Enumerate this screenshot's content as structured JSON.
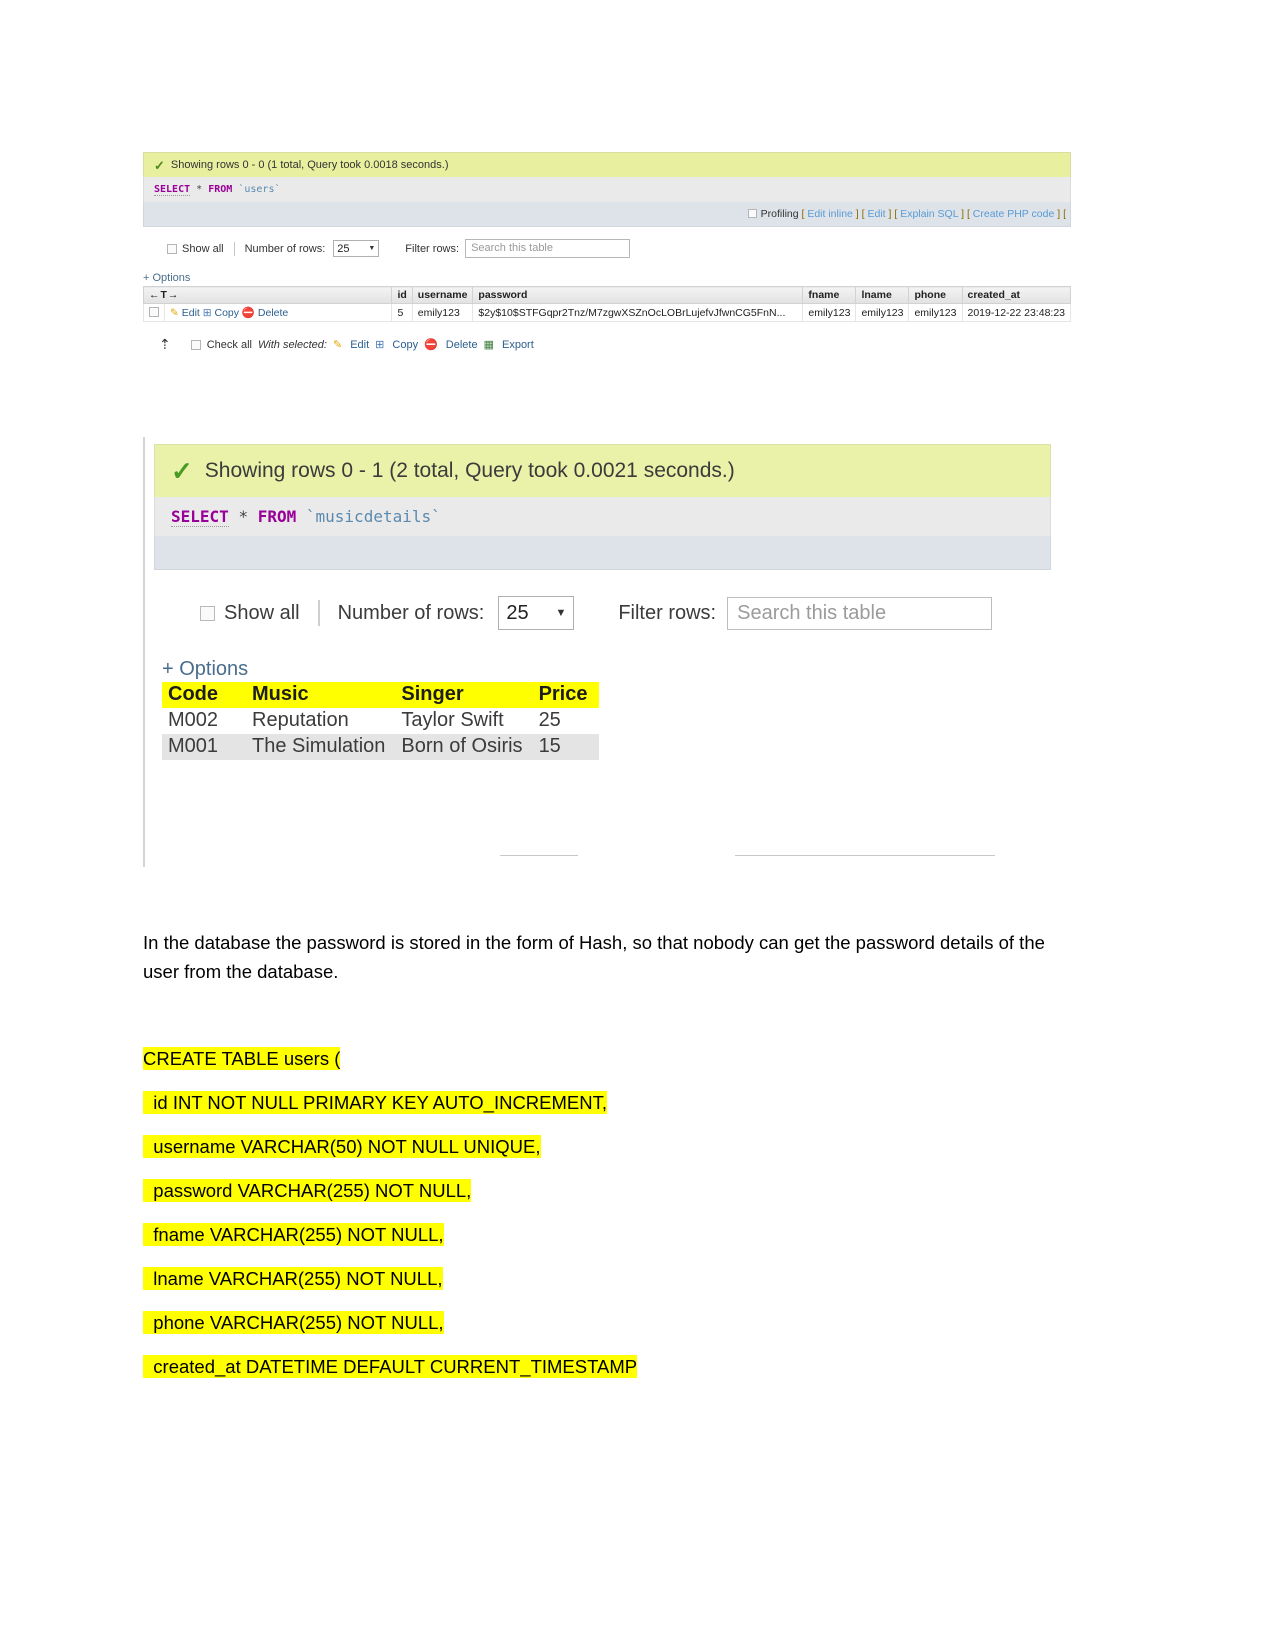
{
  "shot1": {
    "success_text": "Showing rows 0 - 0 (1 total, Query took 0.0018 seconds.)",
    "sql": {
      "keyword": "SELECT",
      "star": "*",
      "from": "FROM",
      "table": "`users`"
    },
    "links": {
      "profiling": "Profiling",
      "edit_inline": "Edit inline",
      "edit": "Edit",
      "explain_sql": "Explain SQL",
      "create_php": "Create PHP code",
      "bracket_open": "[",
      "bracket_close": "]",
      "pipe": "|"
    },
    "controls": {
      "show_all": "Show all",
      "number_of_rows_label": "Number of rows:",
      "number_of_rows_value": "25",
      "filter_rows_label": "Filter rows:",
      "filter_placeholder": "Search this table"
    },
    "options_label": "+ Options",
    "nav_cell": "←T→",
    "columns": [
      "id",
      "username",
      "password",
      "fname",
      "lname",
      "phone",
      "created_at"
    ],
    "highlighted_columns": [
      "id",
      "username",
      "password",
      "fname",
      "lname",
      "phone",
      "created_at"
    ],
    "actions": {
      "edit": "Edit",
      "copy": "Copy",
      "delete": "Delete"
    },
    "rows": [
      {
        "id": "5",
        "username": "emily123",
        "password": "$2y$10$STFGqpr2Tnz/M7zgwXSZnOcLOBrLujefvJfwnCG5FnN...",
        "fname": "emily123",
        "lname": "emily123",
        "phone": "emily123",
        "created_at": "2019-12-22 23:48:23"
      }
    ],
    "footer": {
      "check_all": "Check all",
      "with_selected": "With selected:",
      "edit": "Edit",
      "copy": "Copy",
      "delete": "Delete",
      "export": "Export"
    }
  },
  "shot2": {
    "success_text": "Showing rows 0 - 1 (2 total, Query took 0.0021 seconds.)",
    "sql": {
      "keyword": "SELECT",
      "star": "*",
      "from": "FROM",
      "table": "`musicdetails`"
    },
    "controls": {
      "show_all": "Show all",
      "number_of_rows_label": "Number of rows:",
      "number_of_rows_value": "25",
      "filter_rows_label": "Filter rows:",
      "filter_placeholder": "Search this table"
    },
    "options_label": "+ Options",
    "columns": [
      "Code",
      "Music",
      "Singer",
      "Price"
    ],
    "rows": [
      {
        "code": "M002",
        "music": "Reputation",
        "singer": "Taylor Swift",
        "price": "25"
      },
      {
        "code": "M001",
        "music": "The Simulation",
        "singer": "Born of Osiris",
        "price": "15"
      }
    ]
  },
  "document": {
    "paragraph": "In the database the password is stored in the form of Hash, so that nobody can get the password details of the user from the database.",
    "sql_lines": [
      "CREATE TABLE users (",
      "  id INT NOT NULL PRIMARY KEY AUTO_INCREMENT,",
      "  username VARCHAR(50) NOT NULL UNIQUE,",
      "  password VARCHAR(255) NOT NULL,",
      "  fname VARCHAR(255) NOT NULL,",
      "  lname VARCHAR(255) NOT NULL,",
      "  phone VARCHAR(255) NOT NULL,",
      "  created_at DATETIME DEFAULT CURRENT_TIMESTAMP"
    ]
  },
  "colors": {
    "highlight": "#ffff00",
    "success_bg": "#e8f0a0",
    "link": "#5a9bd5",
    "sql_keyword": "#990099"
  }
}
